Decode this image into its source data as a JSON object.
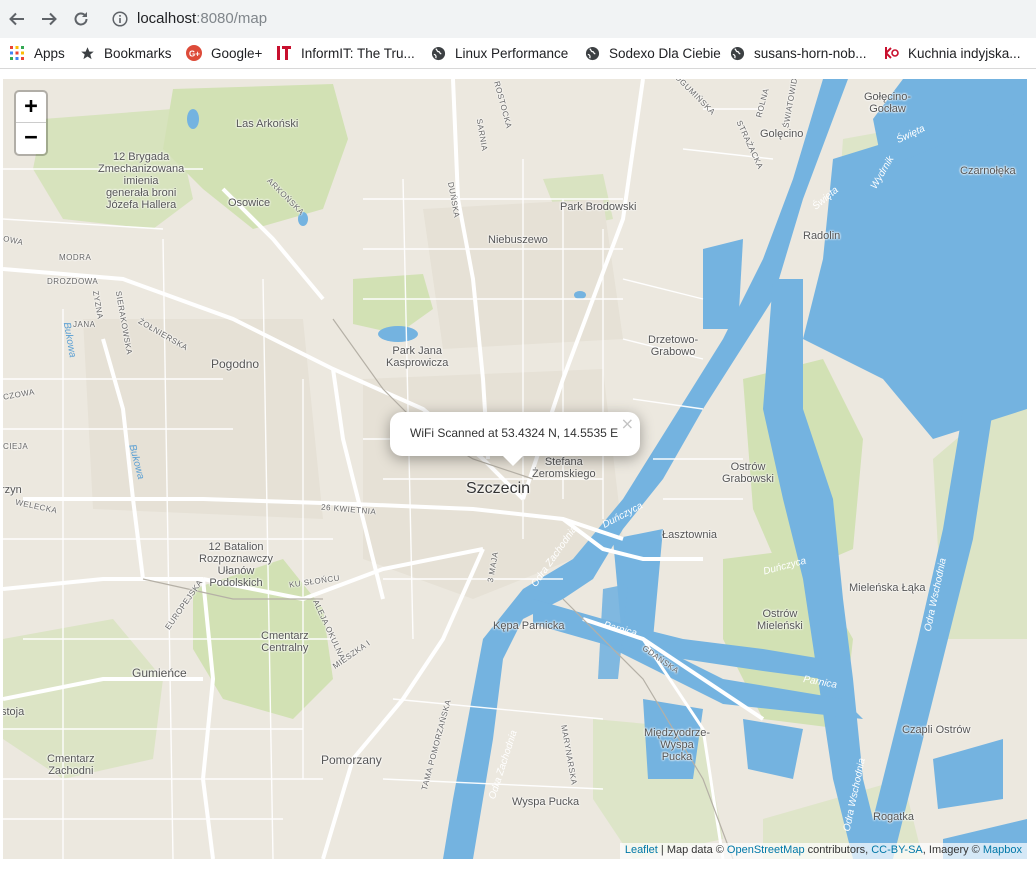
{
  "browser": {
    "url_host": "localhost",
    "url_rest": ":8080/map",
    "nav": {
      "back_icon": "arrow-left-icon",
      "forward_icon": "arrow-right-icon",
      "reload_icon": "reload-icon",
      "info_icon": "info-icon"
    }
  },
  "bookmarks": [
    {
      "label": "Apps",
      "icon": "apps-grid-icon",
      "color": "#4285f4"
    },
    {
      "label": "Bookmarks",
      "icon": "star-icon",
      "color": "#5f6368"
    },
    {
      "label": "Google+",
      "icon": "google-plus-icon",
      "color": "#dd4b39"
    },
    {
      "label": "InformIT: The Tru...",
      "icon": "informit-icon",
      "color": "#c8102e"
    },
    {
      "label": "Linux Performance",
      "icon": "globe-icon",
      "color": "#5f6368"
    },
    {
      "label": "Sodexo Dla Ciebie",
      "icon": "globe-icon",
      "color": "#5f6368"
    },
    {
      "label": "susans-horn-nob...",
      "icon": "globe-icon",
      "color": "#5f6368"
    },
    {
      "label": "Kuchnia indyjska...",
      "icon": "kuchnia-icon",
      "color": "#c8102e"
    }
  ],
  "map": {
    "zoom_in": "+",
    "zoom_out": "−",
    "popup_text": "WiFi Scanned at 53.4324 N, 14.5535 E",
    "popup_close": "×",
    "colors": {
      "land": "#ece8df",
      "water": "#74b3e0",
      "park": "#cfe0b0",
      "road": "#ffffff"
    },
    "attribution": {
      "leaflet": "Leaflet",
      "sep1": " | Map data © ",
      "osm": "OpenStreetMap",
      "sep2": " contributors, ",
      "license": "CC-BY-SA",
      "sep3": ", Imagery © ",
      "mapbox": "Mapbox"
    },
    "labels": {
      "szczecin": "Szczecin",
      "las_arkonski": "Las Arkoński",
      "brygada_1": "12 Brygada",
      "brygada_2": "Zmechanizowana",
      "brygada_3": "imienia",
      "brygada_4": "generała broni",
      "brygada_5": "Józefa Hallera",
      "osowice": "Osowice",
      "park_brodowski": "Park Brodowski",
      "niebuszewo": "Niebuszewo",
      "golecino_goclaw_1": "Gołęcino-",
      "golecino_goclaw_2": "Gocław",
      "golecino": "Golęcino",
      "czarnoleka": "Czarnołęka",
      "radolin": "Radolin",
      "drzetowo_1": "Drzetowo-",
      "drzetowo_2": "Grabowo",
      "park_jana_1": "Park Jana",
      "park_jana_2": "Kasprowicza",
      "pogodno": "Pogodno",
      "stefana_1": "Stefana",
      "stefana_2": "Żeromskiego",
      "ostrow_grab_1": "Ostrów",
      "ostrow_grab_2": "Grabowski",
      "lasztownia": "Łasztownia",
      "batalion_1": "12 Batalion",
      "batalion_2": "Rozpoznawczy",
      "batalion_3": "Ułanów",
      "batalion_4": "Podolskich",
      "mielenska": "Mieleńska Łąka",
      "ostrow_miel_1": "Ostrów",
      "ostrow_miel_2": "Mieleński",
      "kepa": "Kępa Parnicka",
      "cmentarz_c_1": "Cmentarz",
      "cmentarz_c_2": "Centralny",
      "gumience": "Gumieńce",
      "miedzyodrze_1": "Międzyodrze-",
      "miedzyodrze_2": "Wyspa",
      "miedzyodrze_3": "Pucka",
      "czapli": "Czapli Ostrów",
      "pomorzany": "Pomorzany",
      "stoja": "stoja",
      "cmentarz_z_1": "Cmentarz",
      "cmentarz_z_2": "Zachodni",
      "wyspa_pucka": "Wyspa Pucka",
      "rogatka": "Rogatka",
      "zyn": "rzyn",
      "owa": "OWA",
      "modra": "MODRA",
      "drozdowa": "DROZDOWA",
      "jana": "JANA",
      "sierakowska": "SIERAKOWSKA",
      "zolnierska": "ŻOŁNIERSKA",
      "czowa": "CZOWA",
      "cieja": "CIEJA",
      "welecka": "WELECKA",
      "kwietnia": "26 KWIETNIA",
      "europejska": "EUROPEJSKA",
      "kusloncu": "KU SŁOŃCU",
      "okulna": "ALEJA OKULNA",
      "mieszka": "MIESZKA I",
      "gdanska": "GDAŃSKA",
      "pomorzanska": "TAMA POMORZAŃSKA",
      "marynarska": "MARYNARSKA",
      "maja": "3 MAJA",
      "arkonska": "ARKOŃSKA",
      "dunska": "DUŃSKA",
      "sarnia": "SARNIA",
      "rostocka": "ROSTOCKA",
      "bogumin": "BOGUMIŃSKA",
      "rolna": "ROLNA",
      "strazackа": "STRAŻACKA",
      "swiatowida": "ŚWIATOWIDA",
      "zyzna": "ZYZNA",
      "bukowa": "Bukowa",
      "bukowa2": "Bukowa",
      "odra_zach": "Odra Zachodnia",
      "odra_zach2": "Odra Zachodnia",
      "odra_wsch": "Odra Wschodnia",
      "odra_wsch2": "Odra Wschodnia",
      "dunczyca": "Duńczyca",
      "dunczyca2": "Duńczyca",
      "parnica": "Parnica",
      "parnica2": "Parnica",
      "swieta": "Święta",
      "swieta2": "Święta",
      "wydrnik": "Wydrnik"
    }
  }
}
